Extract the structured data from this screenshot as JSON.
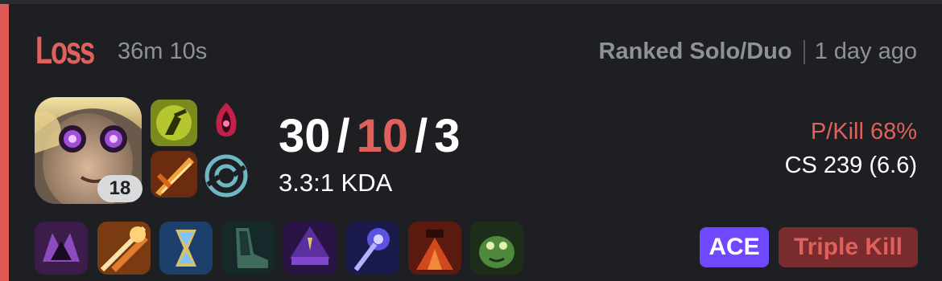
{
  "match": {
    "result": "Loss",
    "duration": "36m 10s",
    "queue": "Ranked Solo/Duo",
    "time_ago": "1 day ago"
  },
  "player": {
    "champion_level": "18",
    "kills": "30",
    "deaths": "10",
    "assists": "3",
    "kda_ratio": "3.3:1 KDA",
    "kill_participation": "P/Kill 68%",
    "cs": "CS 239 (6.6)"
  },
  "spells": [
    "ghost-spell-icon",
    "ignite-spell-icon"
  ],
  "runes": [
    "dark-harvest-rune-icon",
    "sorcery-tree-rune-icon"
  ],
  "items": [
    "item-1-icon",
    "item-2-icon",
    "item-3-icon",
    "item-4-icon",
    "item-5-icon",
    "item-6-icon",
    "trinket-icon",
    "ward-item-icon"
  ],
  "badges": {
    "ace": "ACE",
    "multikill": "Triple Kill"
  },
  "colors": {
    "loss_accent": "#e05a55",
    "ace_badge": "#6f48ff",
    "multikill_badge": "#7a2b2e",
    "background": "#1e1f22"
  }
}
